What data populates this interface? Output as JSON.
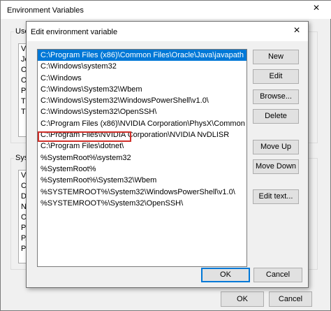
{
  "background_window": {
    "title": "Environment Variables",
    "close": "×",
    "user_group_label": "User",
    "user_vars": [
      "Va",
      "Jet",
      "On",
      "On",
      "Pa",
      "TE",
      "TM"
    ],
    "system_group_label": "Syste",
    "system_vars": [
      "Va",
      "Co",
      "Dr",
      "NU",
      "OS",
      "Pa",
      "PA",
      "PR"
    ],
    "ok_label": "OK",
    "cancel_label": "Cancel"
  },
  "dialog": {
    "title": "Edit environment variable",
    "close": "×",
    "paths": [
      "C:\\Program Files (x86)\\Common Files\\Oracle\\Java\\javapath",
      "C:\\Windows\\system32",
      "C:\\Windows",
      "C:\\Windows\\System32\\Wbem",
      "C:\\Windows\\System32\\WindowsPowerShell\\v1.0\\",
      "C:\\Windows\\System32\\OpenSSH\\",
      "C:\\Program Files (x86)\\NVIDIA Corporation\\PhysX\\Common",
      "C:\\Program Files\\NVIDIA Corporation\\NVIDIA NvDLISR",
      "C:\\Program Files\\dotnet\\",
      "%SystemRoot%\\system32",
      "%SystemRoot%",
      "%SystemRoot%\\System32\\Wbem",
      "%SYSTEMROOT%\\System32\\WindowsPowerShell\\v1.0\\",
      "%SYSTEMROOT%\\System32\\OpenSSH\\"
    ],
    "selected_index": 0,
    "buttons": {
      "new": "New",
      "edit": "Edit",
      "browse": "Browse...",
      "delete": "Delete",
      "move_up": "Move Up",
      "move_down": "Move Down",
      "edit_text": "Edit text...",
      "ok": "OK",
      "cancel": "Cancel"
    }
  },
  "colors": {
    "selection": "#0078d7",
    "highlight_box": "#d0302a"
  }
}
